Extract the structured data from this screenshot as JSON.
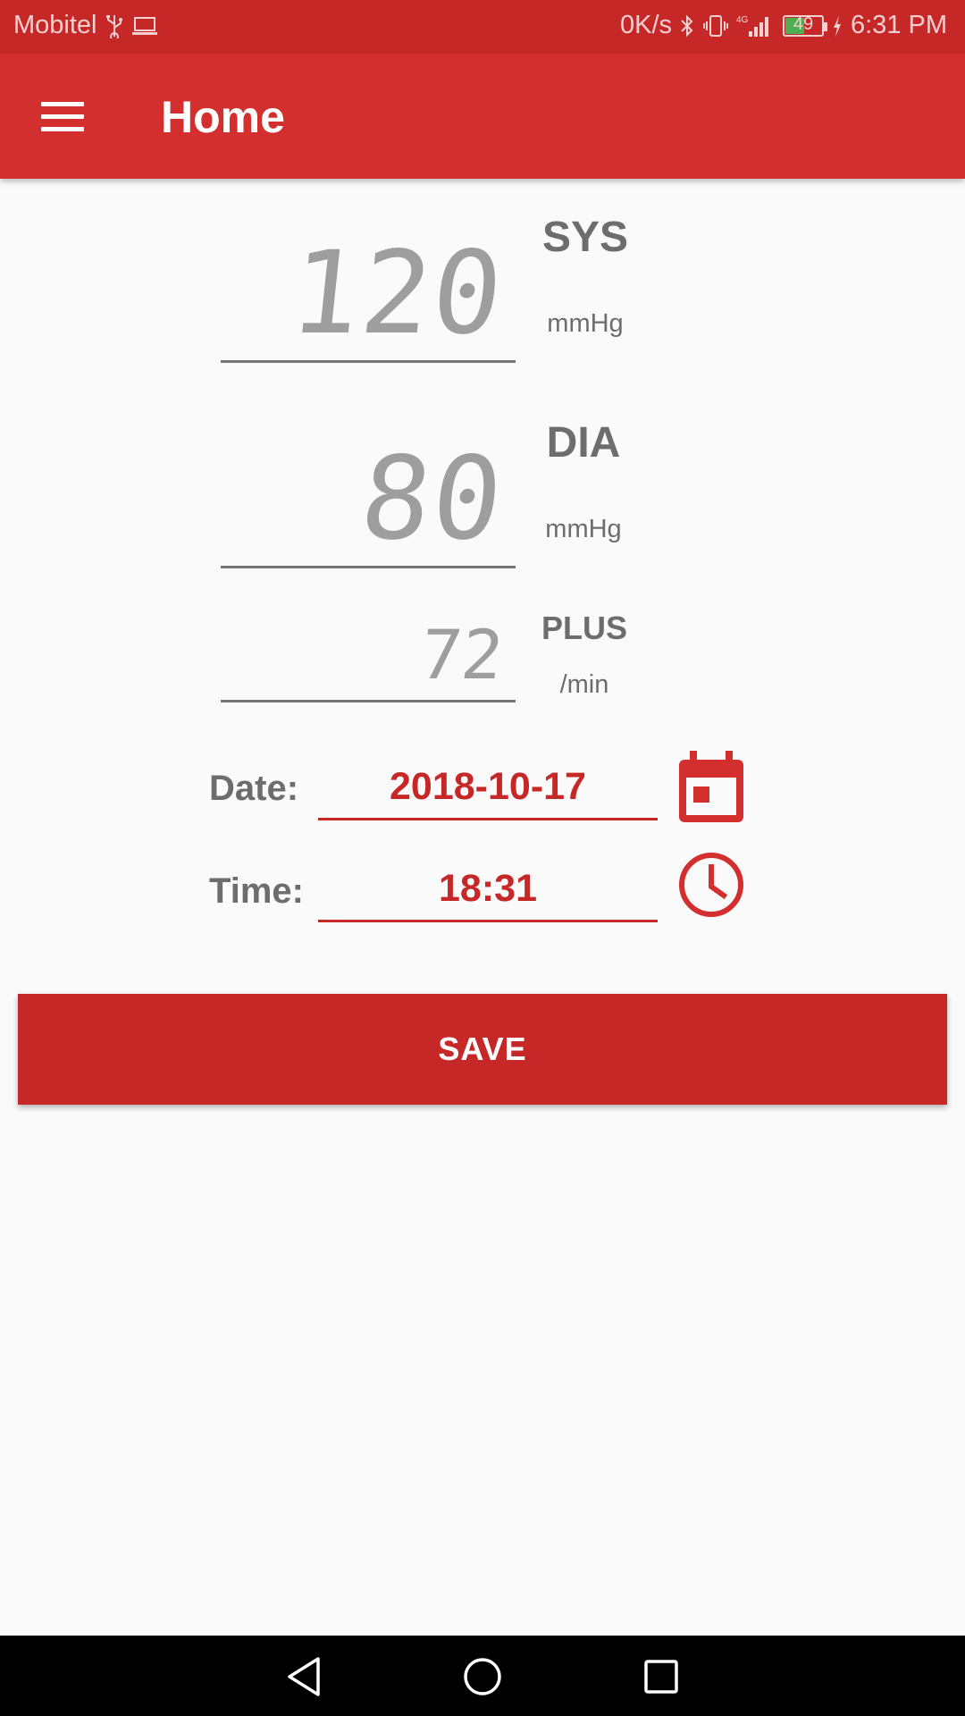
{
  "status_bar": {
    "carrier": "Mobitel",
    "speed": "0K/s",
    "battery": "49",
    "time": "6:31 PM"
  },
  "app_bar": {
    "title": "Home"
  },
  "readings": {
    "sys": {
      "value": "120",
      "label": "SYS",
      "unit": "mmHg"
    },
    "dia": {
      "value": "80",
      "label": "DIA",
      "unit": "mmHg"
    },
    "pulse": {
      "value": "72",
      "label": "PLUS",
      "unit": "/min"
    }
  },
  "date_row": {
    "label": "Date:",
    "value": "2018-10-17"
  },
  "time_row": {
    "label": "Time:",
    "value": "18:31"
  },
  "save_label": "SAVE",
  "colors": {
    "primary": "#d32f2f",
    "primary_dark": "#c62828",
    "text_gray": "#6d6d6d",
    "lcd_gray": "#9e9e9e"
  },
  "icons": {
    "menu": "hamburger-icon",
    "date": "calendar-icon",
    "time": "clock-icon"
  }
}
